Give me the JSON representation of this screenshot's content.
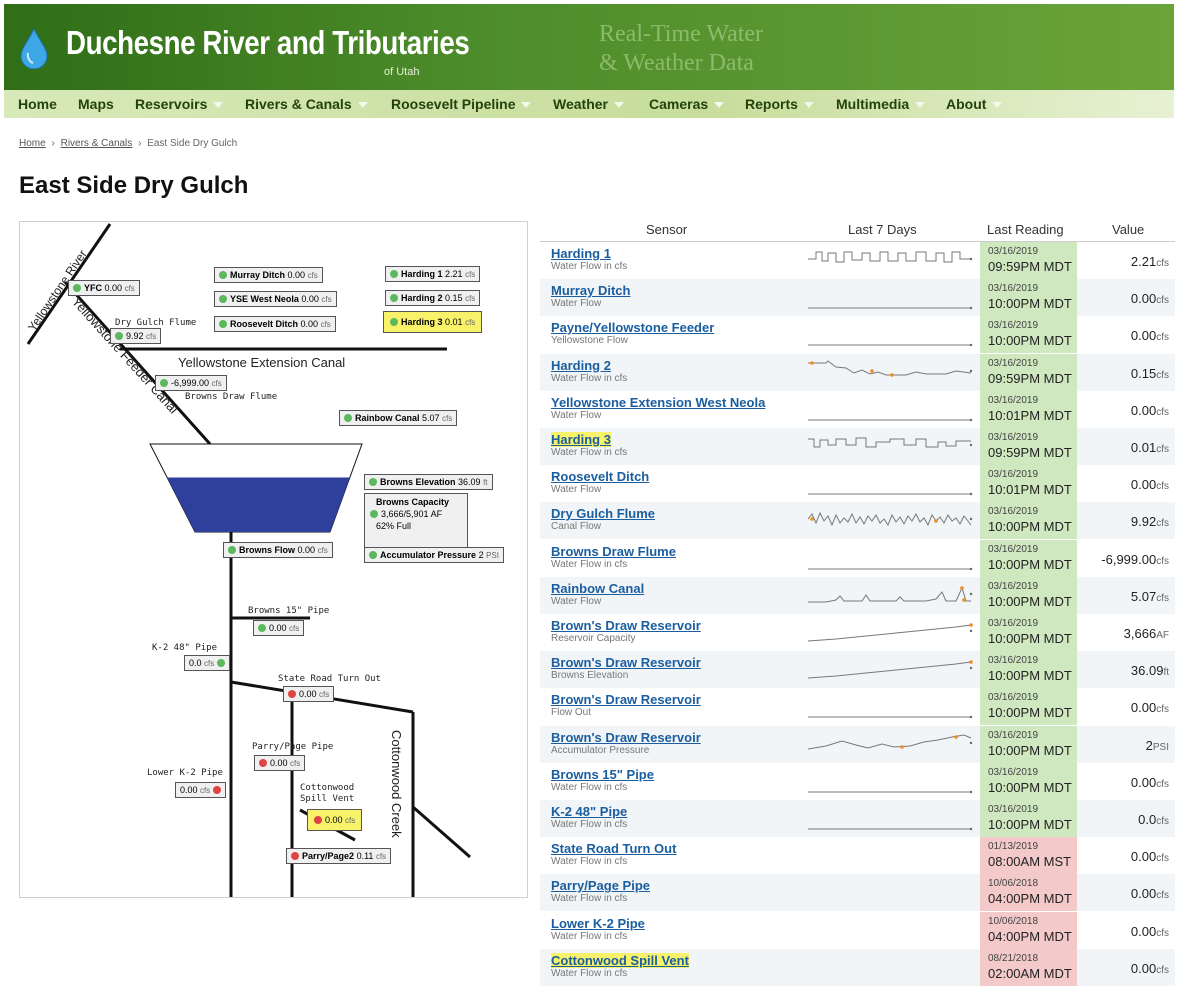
{
  "header": {
    "title": "Duchesne River and Tributaries",
    "subtitle": "of Utah",
    "tagline_1": "Real-Time Water",
    "tagline_2": "& Weather Data"
  },
  "nav": [
    "Home",
    "Maps",
    "Reservoirs",
    "Rivers & Canals",
    "Roosevelt Pipeline",
    "Weather",
    "Cameras",
    "Reports",
    "Multimedia",
    "About"
  ],
  "breadcrumb": {
    "home": "Home",
    "section": "Rivers & Canals",
    "current": "East Side Dry Gulch",
    "sep": "›"
  },
  "page_title": "East Side Dry Gulch",
  "diagram": {
    "rivers": {
      "yellowstone_river": "Yellowstone River",
      "feeder_canal": "Yellowstone Feeder Canal",
      "extension_canal": "Yellowstone Extension Canal",
      "cottonwood_creek": "Cottonwood Creek"
    },
    "labels": {
      "dry_gulch_flume": "Dry Gulch Flume",
      "browns_draw_flume": "Browns Draw Flume",
      "browns_15_pipe": "Browns 15\" Pipe",
      "k2_48_pipe": "K-2 48\" Pipe",
      "state_road": "State Road Turn Out",
      "parry_page_pipe": "Parry/Page Pipe",
      "lower_k2": "Lower K-2 Pipe",
      "cottonwood_1": "Cottonwood",
      "cottonwood_2": "Spill Vent"
    },
    "sensors": {
      "yfc": {
        "name": "YFC",
        "value": "0.00",
        "unit": "cfs"
      },
      "murray": {
        "name": "Murray Ditch",
        "value": "0.00",
        "unit": "cfs"
      },
      "ysewest": {
        "name": "YSE West Neola",
        "value": "0.00",
        "unit": "cfs"
      },
      "roosevelt": {
        "name": "Roosevelt Ditch",
        "value": "0.00",
        "unit": "cfs"
      },
      "harding1": {
        "name": "Harding 1",
        "value": "2.21",
        "unit": "cfs"
      },
      "harding2": {
        "name": "Harding 2",
        "value": "0.15",
        "unit": "cfs"
      },
      "harding3": {
        "name": "Harding 3",
        "value": "0.01",
        "unit": "cfs"
      },
      "drygulch": {
        "value": "9.92",
        "unit": "cfs"
      },
      "brownsdraw": {
        "value": "-6,999.00",
        "unit": "cfs"
      },
      "rainbow": {
        "name": "Rainbow Canal",
        "value": "5.07",
        "unit": "cfs"
      },
      "elevation": {
        "name": "Browns Elevation",
        "value": "36.09",
        "unit": "ft"
      },
      "capacity": {
        "name": "Browns Capacity",
        "value": "3,666/5,901",
        "unit": "AF",
        "pct": "62% Full"
      },
      "accum": {
        "name": "Accumulator Pressure",
        "value": "2",
        "unit": "PSI"
      },
      "brownsflow": {
        "name": "Browns Flow",
        "value": "0.00",
        "unit": "cfs"
      },
      "b15": {
        "value": "0.00",
        "unit": "cfs"
      },
      "k2": {
        "value": "0.0",
        "unit": "cfs"
      },
      "stateroad": {
        "value": "0.00",
        "unit": "cfs"
      },
      "parry": {
        "value": "0.00",
        "unit": "cfs"
      },
      "lowerk2": {
        "value": "0.00",
        "unit": "cfs"
      },
      "cottonwood": {
        "value": "0.00",
        "unit": "cfs"
      },
      "parry2": {
        "name": "Parry/Page2",
        "value": "0.11",
        "unit": "cfs"
      }
    },
    "reservoir_fill_fraction": 0.62
  },
  "table": {
    "headers": [
      "Sensor",
      "Last 7 Days",
      "Last Reading",
      "Value"
    ],
    "rows": [
      {
        "name": "Harding 1",
        "sub": "Water Flow in cfs",
        "date": "03/16/2019",
        "time": "09:59PM MDT",
        "value": "2.21",
        "unit": "cfs",
        "status": "ok",
        "spark": "square"
      },
      {
        "name": "Murray Ditch",
        "sub": "Water Flow",
        "date": "03/16/2019",
        "time": "10:00PM MDT",
        "value": "0.00",
        "unit": "cfs",
        "status": "ok",
        "spark": "flat"
      },
      {
        "name": "Payne/Yellowstone Feeder",
        "sub": "Yellowstone Flow",
        "date": "03/16/2019",
        "time": "10:00PM MDT",
        "value": "0.00",
        "unit": "cfs",
        "status": "ok",
        "spark": "flat"
      },
      {
        "name": "Harding 2",
        "sub": "Water Flow in cfs",
        "date": "03/16/2019",
        "time": "09:59PM MDT",
        "value": "0.15",
        "unit": "cfs",
        "status": "ok",
        "spark": "decay"
      },
      {
        "name": "Yellowstone Extension West Neola",
        "sub": "Water Flow",
        "date": "03/16/2019",
        "time": "10:01PM MDT",
        "value": "0.00",
        "unit": "cfs",
        "status": "ok",
        "spark": "flat"
      },
      {
        "name": "Harding 3",
        "sub": "Water Flow in cfs",
        "date": "03/16/2019",
        "time": "09:59PM MDT",
        "value": "0.01",
        "unit": "cfs",
        "status": "ok",
        "spark": "square2",
        "highlight": true
      },
      {
        "name": "Roosevelt Ditch",
        "sub": "Water Flow",
        "date": "03/16/2019",
        "time": "10:01PM MDT",
        "value": "0.00",
        "unit": "cfs",
        "status": "ok",
        "spark": "flat"
      },
      {
        "name": "Dry Gulch Flume",
        "sub": "Canal Flow",
        "date": "03/16/2019",
        "time": "10:00PM MDT",
        "value": "9.92",
        "unit": "cfs",
        "status": "ok",
        "spark": "noise"
      },
      {
        "name": "Browns Draw Flume",
        "sub": "Water Flow in cfs",
        "date": "03/16/2019",
        "time": "10:00PM MDT",
        "value": "-6,999.00",
        "unit": "cfs",
        "status": "ok",
        "spark": "flat"
      },
      {
        "name": "Rainbow Canal",
        "sub": "Water Flow",
        "date": "03/16/2019",
        "time": "10:00PM MDT",
        "value": "5.07",
        "unit": "cfs",
        "status": "ok",
        "spark": "bumps"
      },
      {
        "name": "Brown's Draw Reservoir",
        "sub": "Reservoir Capacity",
        "date": "03/16/2019",
        "time": "10:00PM MDT",
        "value": "3,666",
        "unit": "AF",
        "status": "ok",
        "spark": "rise"
      },
      {
        "name": "Brown's Draw Reservoir",
        "sub": "Browns Elevation",
        "date": "03/16/2019",
        "time": "10:00PM MDT",
        "value": "36.09",
        "unit": "ft",
        "status": "ok",
        "spark": "rise"
      },
      {
        "name": "Brown's Draw Reservoir",
        "sub": "Flow Out",
        "date": "03/16/2019",
        "time": "10:00PM MDT",
        "value": "0.00",
        "unit": "cfs",
        "status": "ok",
        "spark": "flat"
      },
      {
        "name": "Brown's Draw Reservoir",
        "sub": "Accumulator Pressure",
        "date": "03/16/2019",
        "time": "10:00PM MDT",
        "value": "2",
        "unit": "PSI",
        "status": "ok",
        "spark": "wave"
      },
      {
        "name": "Browns 15\" Pipe",
        "sub": "Water Flow in cfs",
        "date": "03/16/2019",
        "time": "10:00PM MDT",
        "value": "0.00",
        "unit": "cfs",
        "status": "ok",
        "spark": "flat"
      },
      {
        "name": "K-2 48\" Pipe",
        "sub": "Water Flow in cfs",
        "date": "03/16/2019",
        "time": "10:00PM MDT",
        "value": "0.0",
        "unit": "cfs",
        "status": "ok",
        "spark": "flat"
      },
      {
        "name": "State Road Turn Out",
        "sub": "Water Flow in cfs",
        "date": "01/13/2019",
        "time": "08:00AM MST",
        "value": "0.00",
        "unit": "cfs",
        "status": "bad",
        "spark": "none"
      },
      {
        "name": "Parry/Page Pipe",
        "sub": "Water Flow in cfs",
        "date": "10/06/2018",
        "time": "04:00PM MDT",
        "value": "0.00",
        "unit": "cfs",
        "status": "bad",
        "spark": "none"
      },
      {
        "name": "Lower K-2 Pipe",
        "sub": "Water Flow in cfs",
        "date": "10/06/2018",
        "time": "04:00PM MDT",
        "value": "0.00",
        "unit": "cfs",
        "status": "bad",
        "spark": "none"
      },
      {
        "name": "Cottonwood Spill Vent",
        "sub": "Water Flow in cfs",
        "date": "08/21/2018",
        "time": "02:00AM MDT",
        "value": "0.00",
        "unit": "cfs",
        "status": "bad",
        "spark": "none",
        "highlight": true
      }
    ]
  },
  "colors": {
    "ok": "#cfe8bf",
    "bad": "#f3c9c9",
    "link": "#1b5ea0",
    "highlight": "#f7f26a",
    "water": "#2f3f9c"
  }
}
